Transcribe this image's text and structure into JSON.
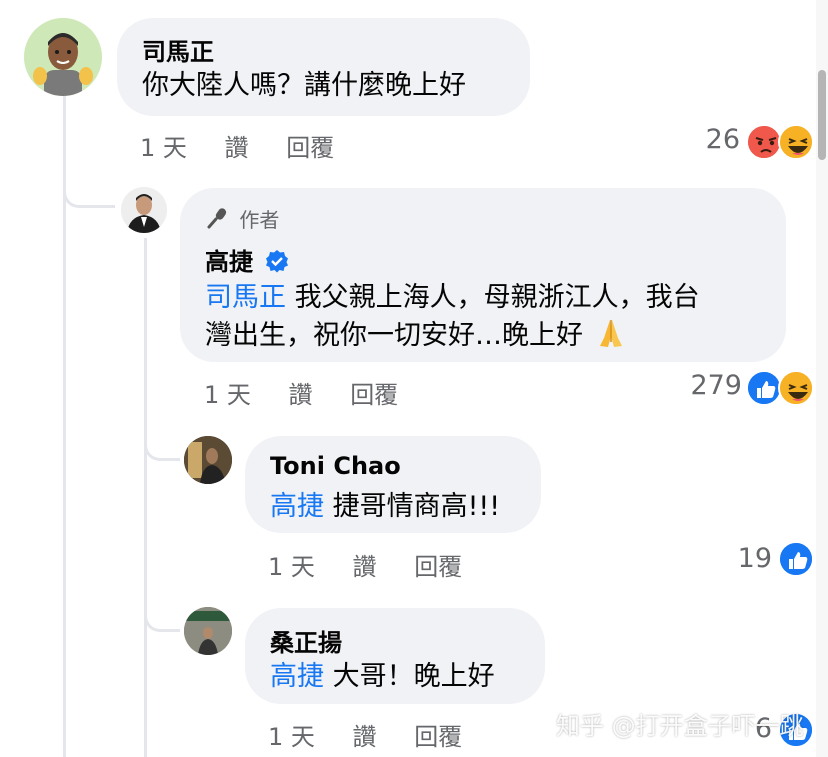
{
  "comments": [
    {
      "author": "司馬正",
      "body": "你大陸人嗎？講什麼晚上好",
      "time": "1 天",
      "like_label": "讚",
      "reply_label": "回覆",
      "reaction_count": "26",
      "reactions": [
        "angry-icon",
        "haha-icon"
      ]
    },
    {
      "author_badge": "作者",
      "author": "高捷",
      "mention": "司馬正",
      "body_line1": " 我父親上海人，母親浙江人，我台",
      "body_line2": "灣出生，祝你一切安好…晚上好",
      "time": "1 天",
      "like_label": "讚",
      "reply_label": "回覆",
      "reaction_count": "279",
      "reactions": [
        "like-icon",
        "haha-icon"
      ]
    },
    {
      "author": "Toni Chao",
      "mention": "高捷",
      "body": " 捷哥情商高!!!",
      "time": "1 天",
      "like_label": "讚",
      "reply_label": "回覆",
      "reaction_count": "19",
      "reactions": [
        "like-icon"
      ]
    },
    {
      "author": "桑正揚",
      "mention": "高捷",
      "body": " 大哥！晚上好",
      "time": "1 天",
      "like_label": "讚",
      "reply_label": "回覆",
      "reaction_count": "6",
      "reactions": [
        "like-icon"
      ]
    }
  ],
  "watermark": "知乎 @打开盒子吓一跳",
  "colors": {
    "bubble": "#f0f2f5",
    "mention": "#1877f2",
    "meta": "#65676b",
    "like": "#1877f2",
    "angry": "#f0584c",
    "haha": "#f7b125",
    "verified": "#1877f2"
  }
}
